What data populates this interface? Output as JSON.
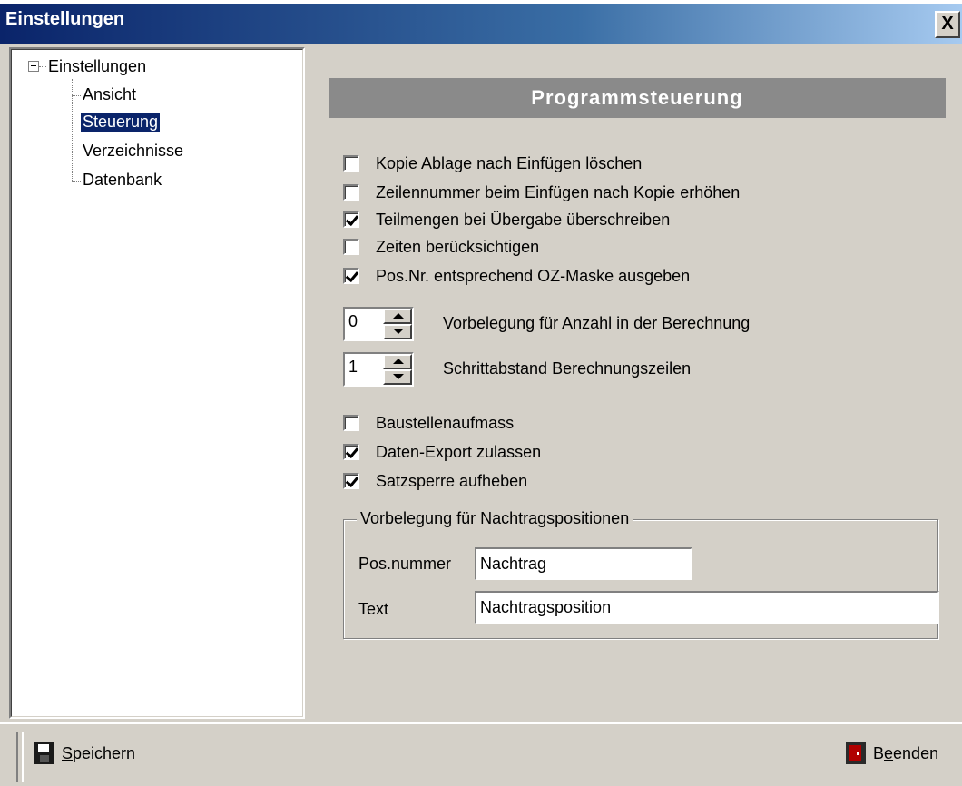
{
  "window": {
    "title": "Einstellungen",
    "close_label": "X"
  },
  "tree": {
    "root": "Einstellungen",
    "items": [
      {
        "label": "Ansicht"
      },
      {
        "label": "Steuerung",
        "selected": true
      },
      {
        "label": "Verzeichnisse"
      },
      {
        "label": "Datenbank"
      }
    ]
  },
  "panel": {
    "heading": "Programmsteuerung",
    "checkboxes": [
      {
        "label": "Kopie Ablage nach Einfügen löschen",
        "checked": false
      },
      {
        "label": "Zeilennummer beim Einfügen nach Kopie erhöhen",
        "checked": false
      },
      {
        "label": "Teilmengen bei Übergabe überschreiben",
        "checked": true
      },
      {
        "label": "Zeiten berücksichtigen",
        "checked": false
      },
      {
        "label": "Pos.Nr. entsprechend OZ-Maske ausgeben",
        "checked": true
      }
    ],
    "spinners": [
      {
        "value": "0",
        "label": "Vorbelegung für Anzahl in der Berechnung"
      },
      {
        "value": "1",
        "label": "Schrittabstand Berechnungszeilen"
      }
    ],
    "checkboxes2": [
      {
        "label": "Baustellenaufmass",
        "checked": false
      },
      {
        "label": "Daten-Export zulassen",
        "checked": true
      },
      {
        "label": "Satzsperre aufheben",
        "checked": true
      }
    ],
    "group": {
      "legend": "Vorbelegung für Nachtragspositionen",
      "posnummer_label": "Pos.nummer",
      "posnummer_value": "Nachtrag",
      "text_label": "Text",
      "text_value": "Nachtragsposition"
    }
  },
  "statusbar": {
    "save_label_first": "S",
    "save_label_rest": "peichern",
    "exit_label_first": "B",
    "exit_label_mid": "e",
    "exit_label_rest": "enden"
  },
  "colors": {
    "titlebar_start": "#0a246a",
    "titlebar_end": "#a6caf0",
    "selection": "#0a246a",
    "heading_bg": "#8a8a8a",
    "face": "#d4d0c8"
  }
}
